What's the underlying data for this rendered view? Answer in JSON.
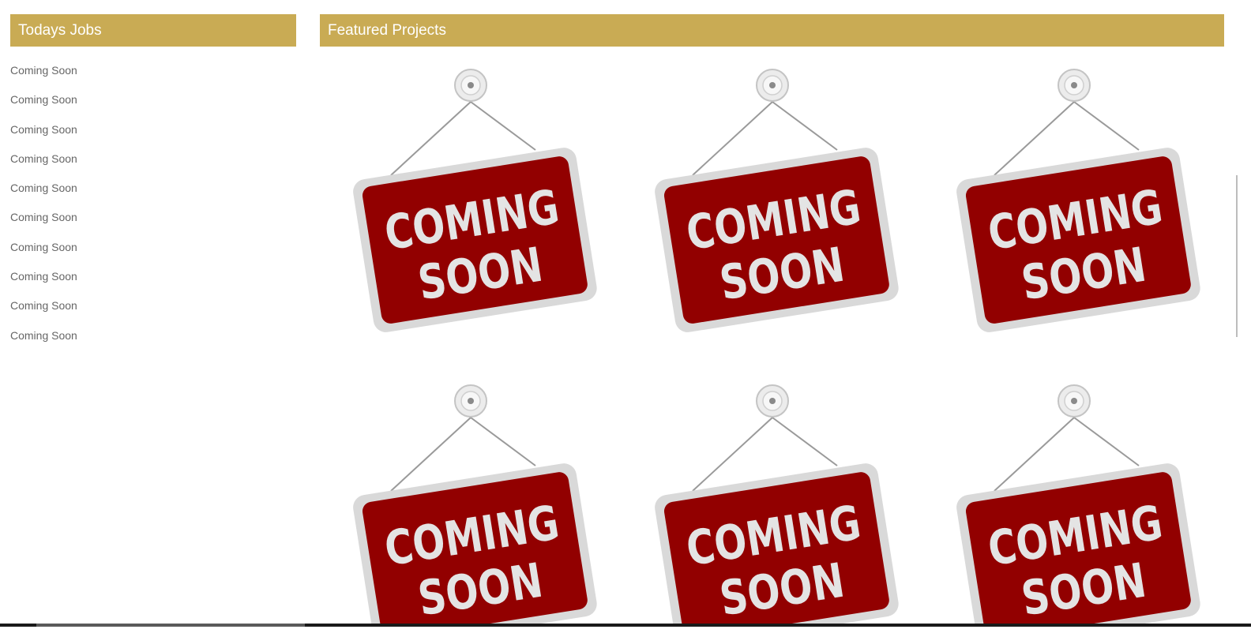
{
  "jobs": {
    "title": "Todays Jobs",
    "items": [
      {
        "label": "Coming Soon"
      },
      {
        "label": "Coming Soon"
      },
      {
        "label": "Coming Soon"
      },
      {
        "label": "Coming Soon"
      },
      {
        "label": "Coming Soon"
      },
      {
        "label": "Coming Soon"
      },
      {
        "label": "Coming Soon"
      },
      {
        "label": "Coming Soon"
      },
      {
        "label": "Coming Soon"
      },
      {
        "label": "Coming Soon"
      }
    ]
  },
  "projects": {
    "title": "Featured Projects",
    "cards": [
      {
        "line1": "COMING",
        "line2": "SOON"
      },
      {
        "line1": "COMING",
        "line2": "SOON"
      },
      {
        "line1": "COMING",
        "line2": "SOON"
      },
      {
        "line1": "COMING",
        "line2": "SOON"
      },
      {
        "line1": "COMING",
        "line2": "SOON"
      },
      {
        "line1": "COMING",
        "line2": "SOON"
      }
    ]
  },
  "colors": {
    "header_bg": "#c9ab54",
    "sign_red": "#920000",
    "sign_border": "#d9d9d9",
    "text_muted": "#666666"
  },
  "icons": {
    "sign": "coming-soon-sign-icon",
    "hook": "suction-hook-icon"
  }
}
